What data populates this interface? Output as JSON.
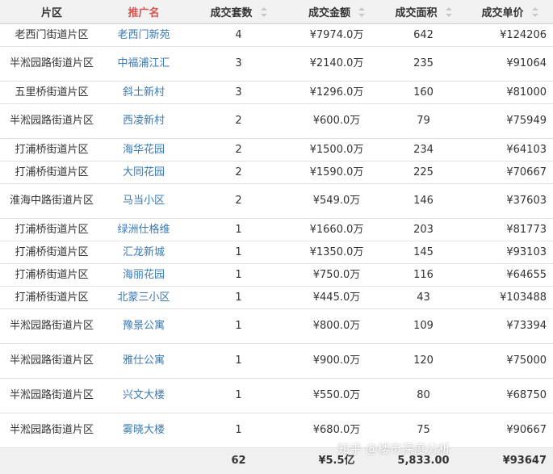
{
  "headers": {
    "district": "片区",
    "name": "推广名",
    "units": "成交套数",
    "amount": "成交金额",
    "area": "成交面积",
    "price": "成交单价"
  },
  "rows": [
    {
      "district": "老西门街道片区",
      "name": "老西门新苑",
      "units": "4",
      "amount": "¥7974.0万",
      "area": "642",
      "price": "¥124206"
    },
    {
      "district": "半淞园路街道片区",
      "name": "中福浦江汇",
      "units": "3",
      "amount": "¥2140.0万",
      "area": "235",
      "price": "¥91064"
    },
    {
      "district": "五里桥街道片区",
      "name": "斜土新村",
      "units": "3",
      "amount": "¥1296.0万",
      "area": "160",
      "price": "¥81000"
    },
    {
      "district": "半淞园路街道片区",
      "name": "西凌新村",
      "units": "2",
      "amount": "¥600.0万",
      "area": "79",
      "price": "¥75949"
    },
    {
      "district": "打浦桥街道片区",
      "name": "海华花园",
      "units": "2",
      "amount": "¥1500.0万",
      "area": "234",
      "price": "¥64103"
    },
    {
      "district": "打浦桥街道片区",
      "name": "大同花园",
      "units": "2",
      "amount": "¥1590.0万",
      "area": "225",
      "price": "¥70667"
    },
    {
      "district": "淮海中路街道片区",
      "name": "马当小区",
      "units": "2",
      "amount": "¥549.0万",
      "area": "146",
      "price": "¥37603"
    },
    {
      "district": "打浦桥街道片区",
      "name": "绿洲仕格维",
      "units": "1",
      "amount": "¥1660.0万",
      "area": "203",
      "price": "¥81773"
    },
    {
      "district": "打浦桥街道片区",
      "name": "汇龙新城",
      "units": "1",
      "amount": "¥1350.0万",
      "area": "145",
      "price": "¥93103"
    },
    {
      "district": "打浦桥街道片区",
      "name": "海丽花园",
      "units": "1",
      "amount": "¥750.0万",
      "area": "116",
      "price": "¥64655"
    },
    {
      "district": "打浦桥街道片区",
      "name": "北蒙三小区",
      "units": "1",
      "amount": "¥445.0万",
      "area": "43",
      "price": "¥103488"
    },
    {
      "district": "半淞园路街道片区",
      "name": "豫景公寓",
      "units": "1",
      "amount": "¥800.0万",
      "area": "109",
      "price": "¥73394"
    },
    {
      "district": "半淞园路街道片区",
      "name": "雅仕公寓",
      "units": "1",
      "amount": "¥900.0万",
      "area": "120",
      "price": "¥75000"
    },
    {
      "district": "半淞园路街道片区",
      "name": "兴文大楼",
      "units": "1",
      "amount": "¥550.0万",
      "area": "80",
      "price": "¥68750"
    },
    {
      "district": "半淞园路街道片区",
      "name": "雾晓大楼",
      "units": "1",
      "amount": "¥680.0万",
      "area": "75",
      "price": "¥90667"
    }
  ],
  "totals": {
    "district": "",
    "name": "",
    "units": "62",
    "amount": "¥5.5亿",
    "area": "5,833.00",
    "price": "¥93647"
  },
  "watermark": "知乎 @楼市深度分析"
}
